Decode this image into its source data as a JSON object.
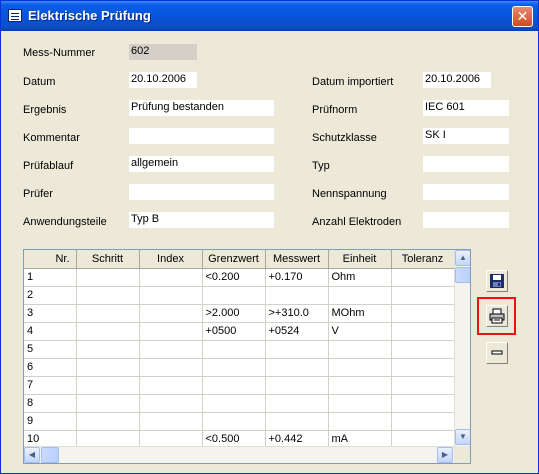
{
  "window": {
    "title": "Elektrische Prüfung",
    "close_glyph": "✕"
  },
  "form": {
    "left": [
      {
        "label": "Mess-Nummer",
        "value": "602"
      },
      {
        "label": "Datum",
        "value": "20.10.2006"
      },
      {
        "label": "Ergebnis",
        "value": "Prüfung bestanden"
      },
      {
        "label": "Kommentar",
        "value": ""
      },
      {
        "label": "Prüfablauf",
        "value": "allgemein"
      },
      {
        "label": "Prüfer",
        "value": ""
      },
      {
        "label": "Anwendungsteile",
        "value": "Typ B"
      }
    ],
    "right": [
      {
        "label": "Datum importiert",
        "value": "20.10.2006"
      },
      {
        "label": "Prüfnorm",
        "value": "IEC 601"
      },
      {
        "label": "Schutzklasse",
        "value": "SK I"
      },
      {
        "label": "Typ",
        "value": ""
      },
      {
        "label": "Nennspannung",
        "value": ""
      },
      {
        "label": "Anzahl Elektroden",
        "value": ""
      }
    ]
  },
  "grid": {
    "columns": [
      "Nr.",
      "Schritt",
      "Index",
      "Grenzwert",
      "Messwert",
      "Einheit",
      "Toleranz"
    ],
    "rows": [
      [
        "1",
        "",
        "",
        "<0.200",
        "+0.170",
        "Ohm",
        ""
      ],
      [
        "2",
        "",
        "",
        "",
        "",
        "",
        ""
      ],
      [
        "3",
        "",
        "",
        ">2.000",
        ">+310.0",
        "MOhm",
        ""
      ],
      [
        "4",
        "",
        "",
        "+0500",
        "+0524",
        "V",
        ""
      ],
      [
        "5",
        "",
        "",
        "",
        "",
        "",
        ""
      ],
      [
        "6",
        "",
        "",
        "",
        "",
        "",
        ""
      ],
      [
        "7",
        "",
        "",
        "",
        "",
        "",
        ""
      ],
      [
        "8",
        "",
        "",
        "",
        "",
        "",
        ""
      ],
      [
        "9",
        "",
        "",
        "",
        "",
        "",
        ""
      ],
      [
        "10",
        "",
        "",
        "<0.500",
        "+0.442",
        "mA",
        ""
      ]
    ]
  },
  "toolbar": {
    "buttons": [
      {
        "name": "save-button",
        "icon": "floppy-disk-icon"
      },
      {
        "name": "print-button",
        "icon": "printer-icon"
      },
      {
        "name": "minus-button",
        "icon": "minus-icon"
      }
    ],
    "highlight_color": "#ee1111"
  }
}
